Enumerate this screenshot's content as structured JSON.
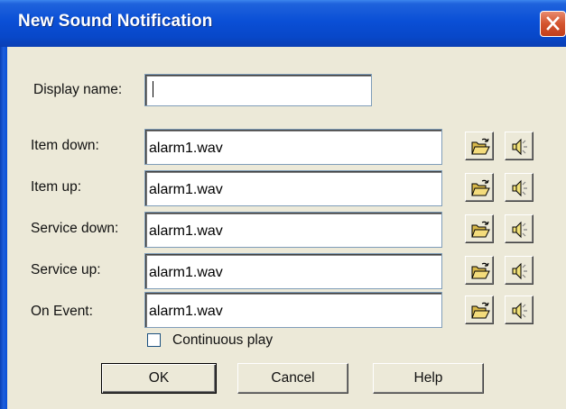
{
  "window": {
    "title": "New Sound Notification"
  },
  "form": {
    "display_name_label": "Display name:",
    "display_name_value": "",
    "rows": [
      {
        "label": "Item down:",
        "value": "alarm1.wav"
      },
      {
        "label": "Item up:",
        "value": "alarm1.wav"
      },
      {
        "label": "Service down:",
        "value": "alarm1.wav"
      },
      {
        "label": "Service up:",
        "value": "alarm1.wav"
      },
      {
        "label": "On Event:",
        "value": "alarm1.wav"
      }
    ],
    "row_icons": {
      "browse": "open-folder-icon",
      "play": "speaker-icon"
    },
    "continuous_play_label": "Continuous play",
    "continuous_play_checked": false
  },
  "buttons": {
    "ok": "OK",
    "cancel": "Cancel",
    "help": "Help"
  },
  "colors": {
    "titlebar": "#0a4fd6",
    "close": "#d4542e",
    "dialog_bg": "#ece9d8"
  }
}
